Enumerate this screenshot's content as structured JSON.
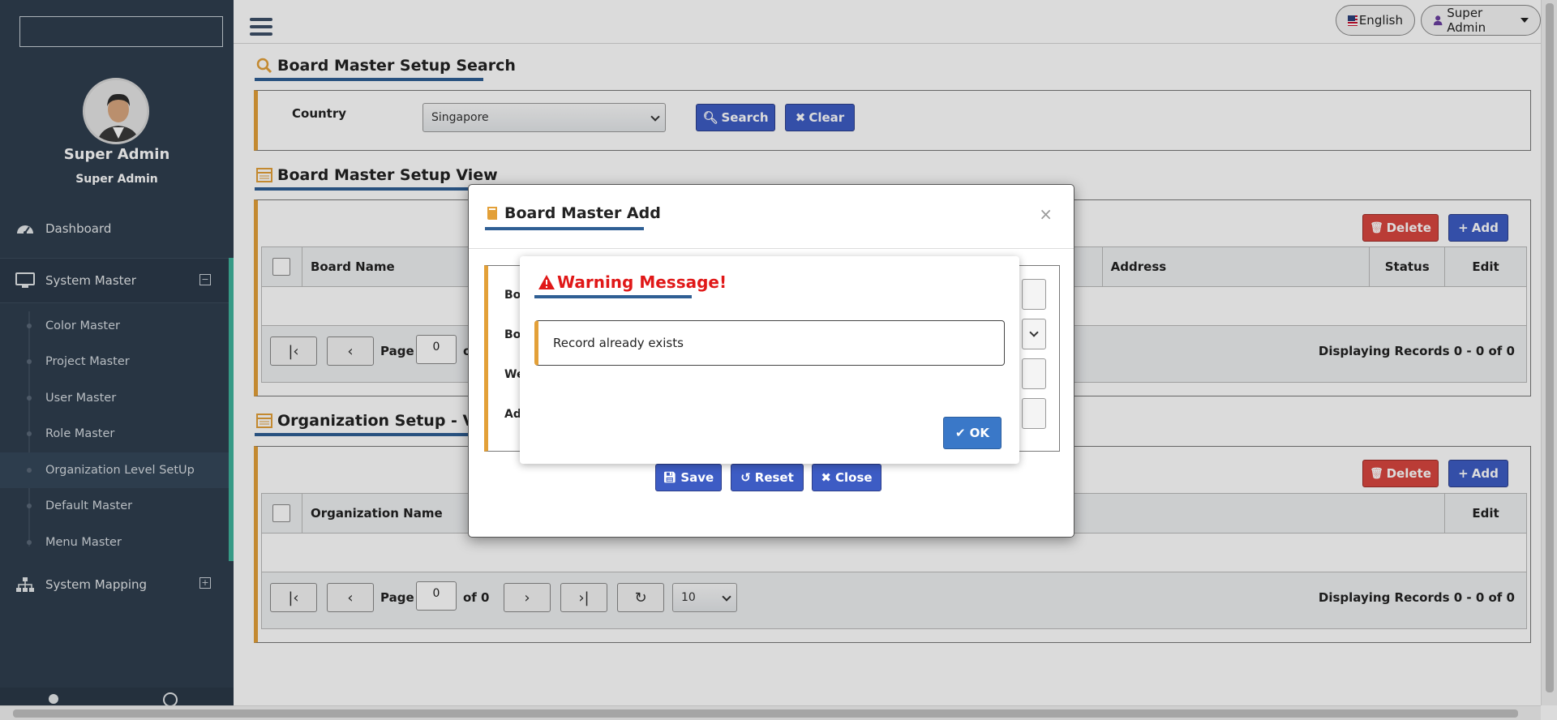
{
  "sidebar": {
    "search_value": "",
    "profile": {
      "name": "Super Admin",
      "role": "Super Admin"
    },
    "nav": {
      "dashboard": "Dashboard",
      "system_master": "System Master",
      "system_mapping": "System Mapping"
    },
    "submenu": [
      {
        "label": "Color Master"
      },
      {
        "label": "Project Master"
      },
      {
        "label": "User Master"
      },
      {
        "label": "Role Master"
      },
      {
        "label": "Organization Level SetUp"
      },
      {
        "label": "Default Master"
      },
      {
        "label": "Menu Master"
      }
    ]
  },
  "topbar": {
    "language": "English",
    "user": "Super Admin"
  },
  "search_section": {
    "title": "Board Master Setup Search",
    "country_label": "Country",
    "country_value": "Singapore",
    "search_button": "Search",
    "clear_button": "Clear"
  },
  "board_view": {
    "title": "Board Master Setup View",
    "delete_button": "Delete",
    "add_button": "Add",
    "columns": {
      "name": "Board Name",
      "address": "Address",
      "status": "Status",
      "edit": "Edit"
    },
    "pager": {
      "page_label": "Page",
      "page_value": "0",
      "of_label": "o",
      "display": "Displaying Records  0 - 0 of 0"
    }
  },
  "org_view": {
    "title": "Organization Setup - Vie",
    "delete_button": "Delete",
    "add_button": "Add",
    "columns": {
      "name": "Organization Name",
      "edit": "Edit"
    },
    "pager": {
      "page_label": "Page",
      "page_value": "0",
      "of_label": "of 0",
      "page_size": "10",
      "display": "Displaying Records  0 - 0 of 0"
    }
  },
  "modal": {
    "title": "Board Master Add",
    "close": "×",
    "labels": [
      "Boa",
      "Boa",
      "Wel",
      "Add"
    ],
    "save_button": "Save",
    "reset_button": "Reset",
    "close_button": "Close"
  },
  "warning": {
    "title": "Warning Message!",
    "message": "Record already exists",
    "ok_button": "OK"
  },
  "colors": {
    "sidebar_bg": "#2f3e4f",
    "accent_orange": "#e3a038",
    "primary_blue": "#3d5cc4",
    "danger_red": "#d9463f",
    "warning_red": "#e01818",
    "teal_accent": "#3fb49c"
  },
  "icons": [
    "search-icon",
    "table-icon",
    "book-icon",
    "dashboard-icon",
    "monitor-icon",
    "sitemap-icon",
    "warning-icon",
    "check-icon",
    "trash-icon",
    "plus-icon",
    "times-icon",
    "save-icon",
    "undo-icon",
    "user-icon",
    "refresh-icon"
  ]
}
